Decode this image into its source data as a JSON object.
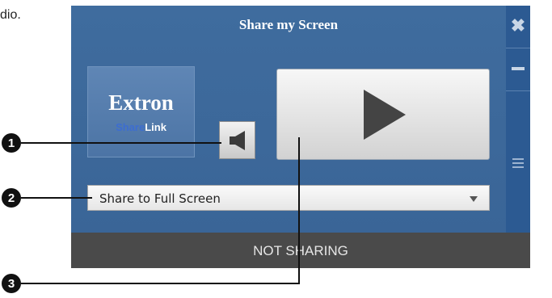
{
  "page": {
    "fragment_text": "dio."
  },
  "window": {
    "title": "Share my Screen",
    "close_glyph": "✖",
    "logo": {
      "brand": "Extron",
      "product_part1": "Share",
      "product_part2": "Link"
    },
    "audio_icon": "speaker-icon",
    "play_icon": "play-icon",
    "share_mode": {
      "value": "Share to Full Screen"
    },
    "status": "NOT SHARING"
  },
  "callouts": [
    {
      "number": "1"
    },
    {
      "number": "2"
    },
    {
      "number": "3"
    }
  ],
  "colors": {
    "window_blue": "#3a6597",
    "side_strip": "#2c5a92",
    "status_bar": "#4a4a4a"
  }
}
